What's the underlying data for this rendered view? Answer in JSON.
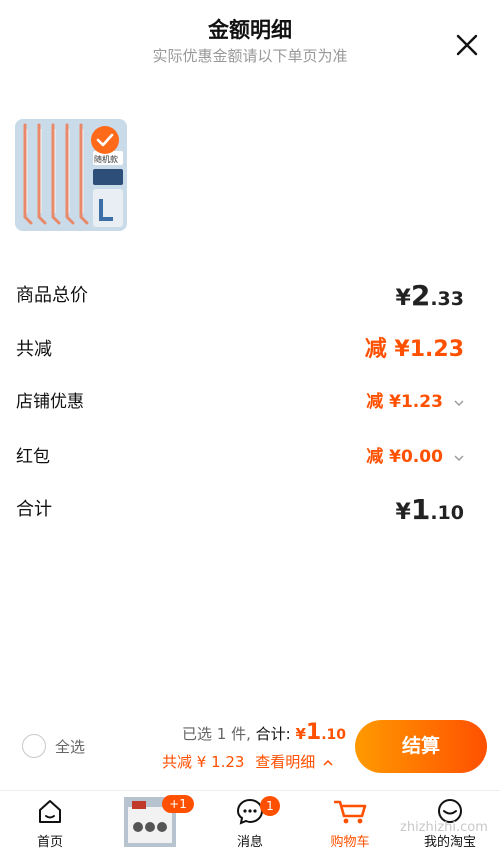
{
  "header": {
    "title": "金额明细",
    "subtitle": "实际优惠金额请以下单页为准"
  },
  "product": {
    "tag_text": "随机款",
    "selected": true
  },
  "rows": {
    "total_label": "商品总价",
    "total_cur": "¥",
    "total_int": "2",
    "total_dec": ".33",
    "reduce_label": "共减",
    "reduce_value": "减 ¥1.23",
    "shop_label": "店铺优惠",
    "shop_value": "减 ¥1.23",
    "redpacket_label": "红包",
    "redpacket_value": "减 ¥0.00",
    "sum_label": "合计",
    "sum_cur": "¥",
    "sum_int": "1",
    "sum_dec": ".10"
  },
  "bottom": {
    "select_all": "全选",
    "selected_text": "已选 1 件,",
    "total_text": "合计:",
    "total_cur": "¥",
    "total_int": "1",
    "total_dec": ".10",
    "reduce_text": "共减 ¥ 1.23",
    "detail_text": "查看明细",
    "checkout": "结算"
  },
  "tabs": [
    {
      "label": "首页",
      "icon": "home-icon"
    },
    {
      "label": "",
      "icon": "product-promo-thumbnail",
      "badge": "+1"
    },
    {
      "label": "消息",
      "icon": "message-icon",
      "badge": "1"
    },
    {
      "label": "购物车",
      "icon": "cart-icon"
    },
    {
      "label": "我的淘宝",
      "icon": "profile-icon"
    }
  ],
  "watermark": "zhizhizhi.com",
  "colors": {
    "accent": "#ff5000",
    "gradient_start": "#ff9a00"
  }
}
